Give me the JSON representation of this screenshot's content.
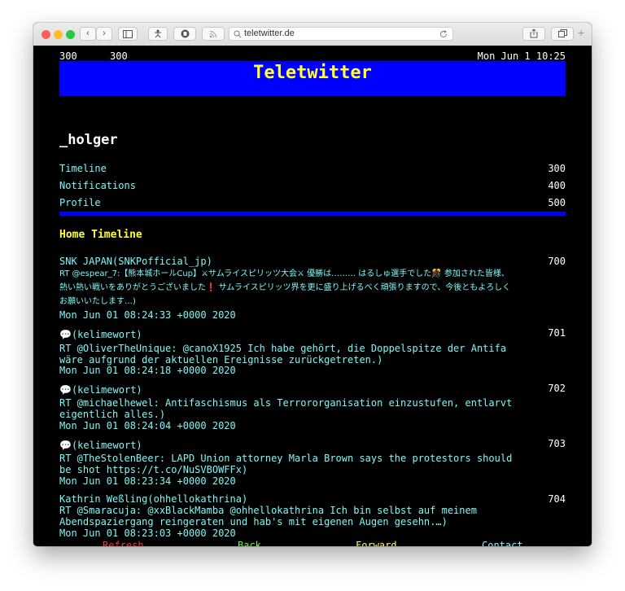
{
  "browser": {
    "url": "teletwitter.de",
    "back_glyph": "‹",
    "forward_glyph": "›",
    "plus": "+"
  },
  "header": {
    "page_left": "300",
    "page_right": "300",
    "datetime": "Mon Jun 1 10:25",
    "title": "Teletwitter"
  },
  "user": {
    "name": "_holger"
  },
  "menu": [
    {
      "label": "Timeline",
      "page": "300"
    },
    {
      "label": "Notifications",
      "page": "400"
    },
    {
      "label": "Profile",
      "page": "500"
    }
  ],
  "section_title": "Home Timeline",
  "tweets": [
    {
      "author": "SNK JAPAN(SNKPofficial_jp)",
      "page": "700",
      "text": "RT @espear_7:【熊本城ホールCup】⚔サムライスピリッツ大会⚔ 優勝は……… はるしゅ選手でした🎊 参加された皆様、熱い熱い戦いをありがとうございました❗ サムライスピリッツ界を更に盛り上げるべく頑張りますので、今後ともよろしくお願いいたします…)",
      "date": "Mon Jun 01 08:24:33 +0000 2020"
    },
    {
      "author": "💬(kelimewort)",
      "page": "701",
      "text": "RT @OliverTheUnique: @canoX1925 Ich habe gehört, die Doppelspitze der Antifa wäre aufgrund der aktuellen Ereignisse zurückgetreten.)",
      "date": "Mon Jun 01 08:24:18 +0000 2020"
    },
    {
      "author": "💬(kelimewort)",
      "page": "702",
      "text": "RT @michaelhewel: Antifaschismus als Terrororganisation einzustufen, entlarvt eigentlich alles.)",
      "date": "Mon Jun 01 08:24:04 +0000 2020"
    },
    {
      "author": "💬(kelimewort)",
      "page": "703",
      "text": "RT @TheStolenBeer: LAPD Union attorney Marla Brown says the protestors should be shot https://t.co/NuSVBOWFFx)",
      "date": "Mon Jun 01 08:23:34 +0000 2020"
    },
    {
      "author": "Kathrin Weßling(ohhellokathrina)",
      "page": "704",
      "text": "RT @Smaracuja: @xxBlackMamba @ohhellokathrina Ich bin selbst auf meinem Abendspaziergang reingeraten und hab's mit eigenen Augen gesehn.…)",
      "date": "Mon Jun 01 08:23:03 +0000 2020"
    }
  ],
  "footer": {
    "refresh": "Refresh",
    "back": "Back",
    "forward": "Forward",
    "contact": "Contact"
  },
  "colors": {
    "banner": "#0000ff",
    "title": "#ffff33",
    "text_cyan": "#7ff7f7",
    "refresh": "#ff3333",
    "back": "#66ff33",
    "forward": "#ffff33",
    "contact": "#7ff7f7"
  }
}
